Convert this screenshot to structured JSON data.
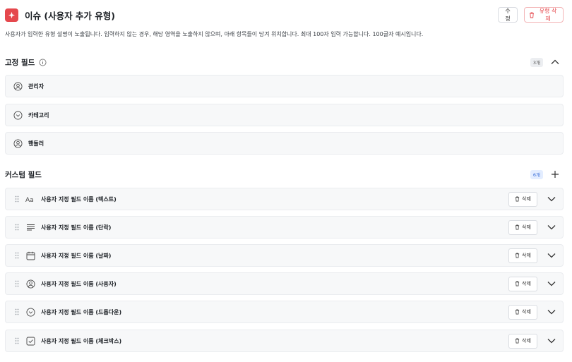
{
  "header": {
    "title": "이슈 (사용자 추가 유형)",
    "edit_label": "수정",
    "delete_type_label": "유형 삭제",
    "accent_color": "#e5484d"
  },
  "description": "사용자가 입력한 유형 설명이 노출됩니다. 입력하지 않는 경우, 해당 영역을 노출하지 않으며, 아래 항목들이 당겨 위치합니다. 최대 100자 입력 가능합니다. 100글자 예시입니다.",
  "fixed_fields": {
    "title": "고정 필드",
    "count": "3개",
    "items": [
      {
        "label": "관리자",
        "icon": "user-icon"
      },
      {
        "label": "카테고리",
        "icon": "dropdown-icon"
      },
      {
        "label": "핸들러",
        "icon": "user-icon"
      }
    ]
  },
  "custom_fields": {
    "title": "커스텀 필드",
    "count": "6개",
    "delete_label": "삭제",
    "items": [
      {
        "label": "사용자 지정 필드 이름 (텍스트)",
        "icon": "text-icon"
      },
      {
        "label": "사용자 지정 필드 이름 (단락)",
        "icon": "paragraph-icon"
      },
      {
        "label": "사용자 지정 필드 이름 (날짜)",
        "icon": "calendar-icon"
      },
      {
        "label": "사용자 지정 필드 이름 (사용자)",
        "icon": "user-icon"
      },
      {
        "label": "사용자 지정 필드 이름 (드롭다운)",
        "icon": "dropdown-icon"
      },
      {
        "label": "사용자 지정 필드 이름 (체크박스)",
        "icon": "checkbox-icon"
      }
    ]
  }
}
